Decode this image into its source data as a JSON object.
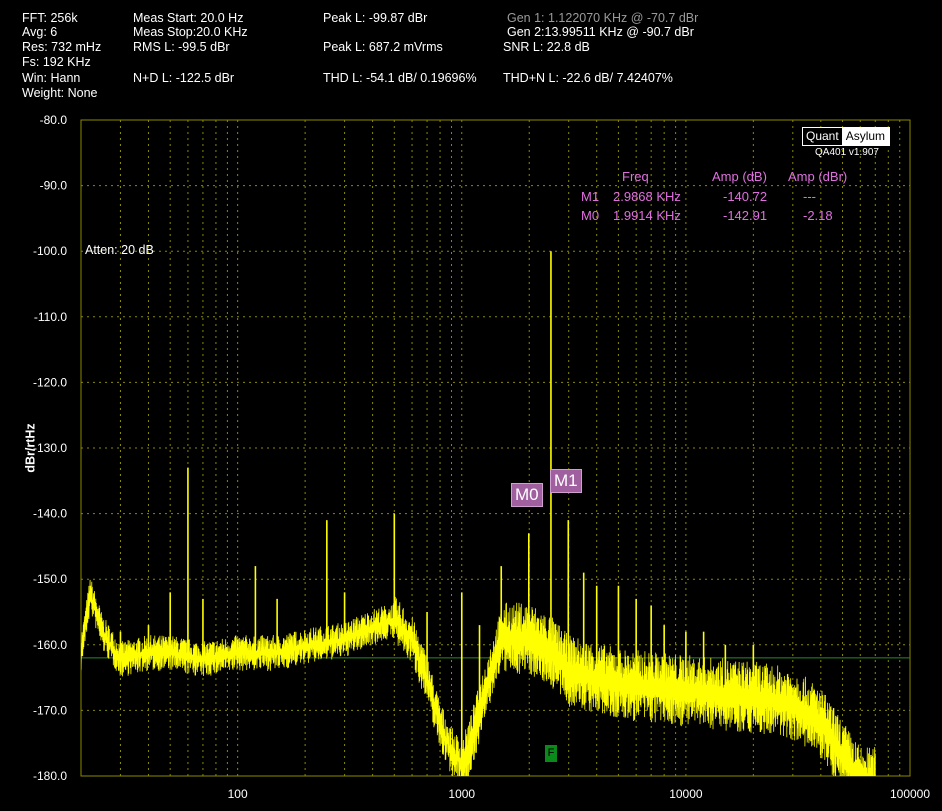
{
  "header": {
    "fft": "FFT: 256k",
    "avg": "Avg: 6",
    "res": "Res: 732 mHz",
    "fs": "Fs: 192 KHz",
    "win": "Win: Hann",
    "weight": "Weight: None",
    "meas_start": "Meas Start: 20.0 Hz",
    "meas_stop": "Meas Stop:20.0 KHz",
    "rms_l": "RMS L: -99.5 dBr",
    "nd_l": "N+D L: -122.5 dBr",
    "peak_l_dbr": "Peak L: -99.87 dBr",
    "peak_l_mv": "Peak L: 687.2 mVrms",
    "thd_l": "THD L: -54.1 dB/ 0.19696%",
    "gen1": "Gen 1: 1.122070 KHz @ -70.7  dBr",
    "gen2": "Gen 2:13.99511 KHz @ -90.7  dBr",
    "snr_l": "SNR L: 22.8 dB",
    "thdn_l": "THD+N L: -22.6 dB/ 7.42407%"
  },
  "brand": {
    "quant": "Quant",
    "asylum": "Asylum",
    "version": "QA401 v1.907"
  },
  "atten": "Atten: 20 dB",
  "marker_table": {
    "headers": {
      "freq": "Freq",
      "amp_db": "Amp (dB)",
      "amp_dbr": "Amp (dBr)"
    },
    "rows": [
      {
        "name": "M1",
        "freq": "2.9868 KHz",
        "amp_db": "-140.72",
        "amp_dbr": "---"
      },
      {
        "name": "M0",
        "freq": "1.9914 KHz",
        "amp_db": "-142.91",
        "amp_dbr": "-2.18"
      }
    ]
  },
  "markers": {
    "m0": "M0",
    "m1": "M1",
    "f": "F"
  },
  "chart_data": {
    "type": "line",
    "ylabel": "dBr/rtHz",
    "xlabel": "",
    "title": "",
    "x_scale": "log",
    "xlim": [
      20,
      100000
    ],
    "ylim": [
      -180,
      -80
    ],
    "yticks": [
      "-80.0",
      "-90.0",
      "-100.0",
      "-110.0",
      "-120.0",
      "-130.0",
      "-140.0",
      "-150.0",
      "-160.0",
      "-170.0",
      "-180.0"
    ],
    "xticks": [
      "100",
      "1000",
      "10000",
      "100000"
    ],
    "reference_line_db": -162,
    "colors": {
      "trace": "#ffff00",
      "grid": "#8a8a00",
      "reference": "#2a8a2a"
    },
    "noise_floor": [
      [
        20,
        -161
      ],
      [
        22,
        -152
      ],
      [
        25,
        -158
      ],
      [
        30,
        -162
      ],
      [
        40,
        -161
      ],
      [
        50,
        -161
      ],
      [
        70,
        -162
      ],
      [
        100,
        -161
      ],
      [
        150,
        -161
      ],
      [
        200,
        -160
      ],
      [
        300,
        -159
      ],
      [
        400,
        -157
      ],
      [
        500,
        -156
      ],
      [
        600,
        -159
      ],
      [
        700,
        -165
      ],
      [
        800,
        -172
      ],
      [
        900,
        -176
      ],
      [
        1000,
        -178
      ],
      [
        1100,
        -174
      ],
      [
        1300,
        -165
      ],
      [
        1500,
        -158
      ],
      [
        2000,
        -158
      ],
      [
        2500,
        -160
      ],
      [
        3000,
        -163
      ],
      [
        5000,
        -165
      ],
      [
        10000,
        -166
      ],
      [
        20000,
        -167
      ],
      [
        30000,
        -168
      ],
      [
        40000,
        -171
      ],
      [
        50000,
        -176
      ],
      [
        60000,
        -180
      ]
    ],
    "spikes": [
      [
        22,
        -151
      ],
      [
        30,
        -158
      ],
      [
        40,
        -157
      ],
      [
        50,
        -152
      ],
      [
        60,
        -133
      ],
      [
        70,
        -153
      ],
      [
        120,
        -148
      ],
      [
        150,
        -153
      ],
      [
        250,
        -141
      ],
      [
        300,
        -152
      ],
      [
        500,
        -140
      ],
      [
        700,
        -155
      ],
      [
        1000,
        -152
      ],
      [
        1200,
        -157
      ],
      [
        1500,
        -148
      ],
      [
        1991,
        -143
      ],
      [
        2500,
        -100
      ],
      [
        2987,
        -141
      ],
      [
        3500,
        -149
      ],
      [
        4000,
        -151
      ],
      [
        5000,
        -151
      ],
      [
        6000,
        -153
      ],
      [
        7000,
        -154
      ],
      [
        8000,
        -157
      ],
      [
        10000,
        -158
      ],
      [
        12000,
        -158
      ],
      [
        15000,
        -160
      ],
      [
        20000,
        -160
      ]
    ]
  }
}
